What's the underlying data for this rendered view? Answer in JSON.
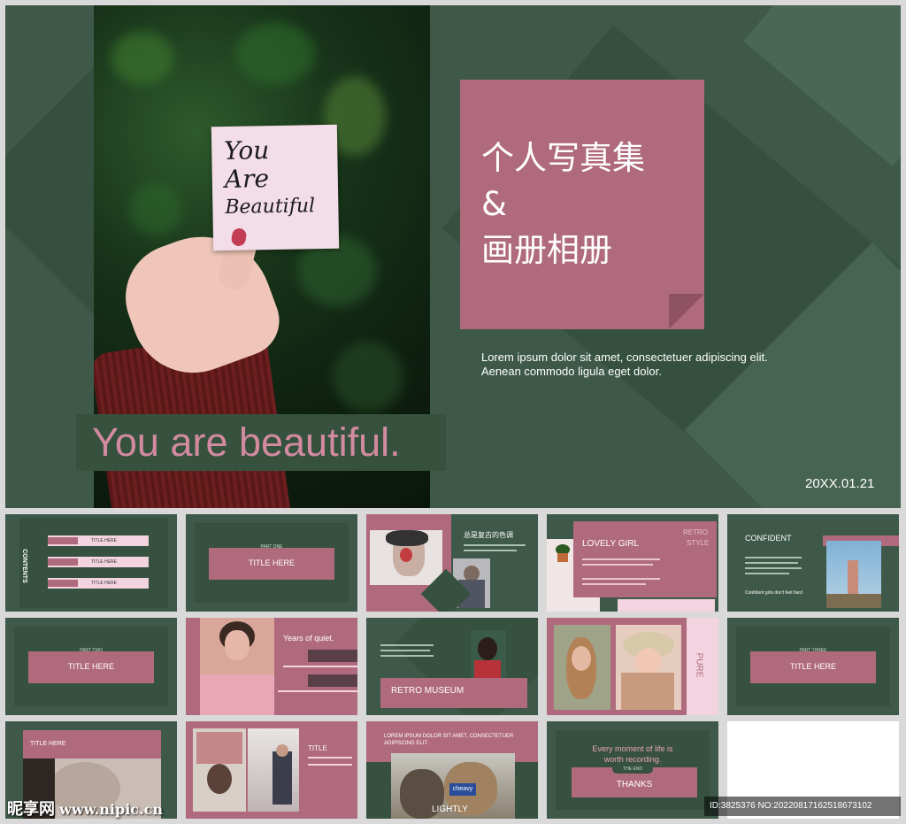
{
  "main": {
    "note_lines": [
      "You",
      "Are",
      "Beautiful"
    ],
    "caption": "You are beautiful.",
    "title_line1": "个人写真集",
    "title_line2": "&",
    "title_line3": "画册相册",
    "lorem_line1": "Lorem ipsum dolor sit amet, consectetuer adipiscing elit.",
    "lorem_line2": "Aenean commodo ligula eget dolor.",
    "date": "20XX.01.21"
  },
  "thumbs": {
    "t1": {
      "side": "CONTENTS",
      "items": [
        "TITLE HERE",
        "TITLE HERE",
        "TITLE HERE"
      ]
    },
    "t2": {
      "pill": "PART ONE",
      "title": "TITLE HERE"
    },
    "t3": {
      "heading": "总是复古的色调"
    },
    "t4": {
      "title": "LOVELY GIRL",
      "side1": "RETRO",
      "side2": "STYLE"
    },
    "t5": {
      "title": "CONFIDENT",
      "caption": "Confident girls don't feel hard"
    },
    "t6": {
      "pill": "PART TWO",
      "title": "TITLE HERE"
    },
    "t7": {
      "heading": "Years of quiet."
    },
    "t8": {
      "title": "RETRO MUSEUM"
    },
    "t9": {
      "side": "PURE"
    },
    "t10": {
      "pill": "PART THREE",
      "title": "TITLE HERE"
    },
    "t11": {
      "title": "TITLE HERE"
    },
    "t12": {
      "title": "TITLE"
    },
    "t13": {
      "heading1": "LOREM IPSUM DOLOR SIT AMET, CONSECTETUER",
      "heading2": "ADIPISCING ELIT.",
      "caption": "LIGHTLY",
      "badge": "cheavy"
    },
    "t14": {
      "line1": "Every moment of life is",
      "line2": "worth recording.",
      "pill": "THE END",
      "title": "THANKS"
    }
  },
  "watermark": {
    "brand": "昵享网",
    "url": "www.nipic.cn"
  },
  "idtag": "ID:3825376 NO:20220817162518673102",
  "colors": {
    "green": "#3e5949",
    "dark_green": "#36513f",
    "pink": "#b06a7d",
    "light_pink": "#f2d3df"
  }
}
